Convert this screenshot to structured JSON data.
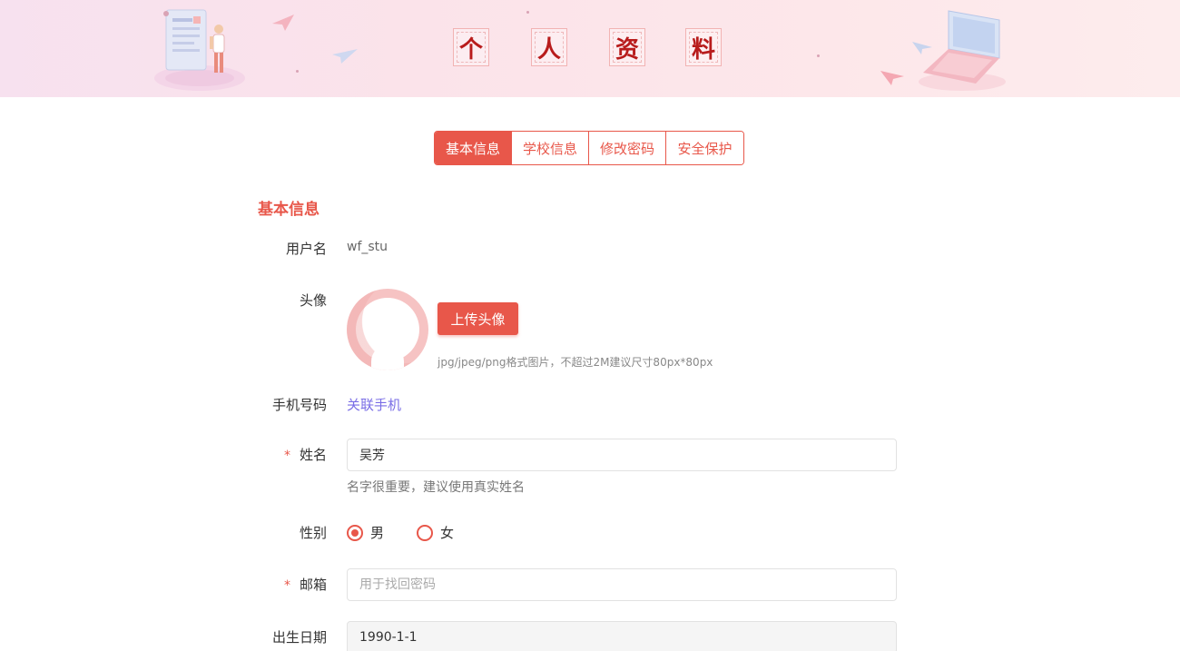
{
  "banner": {
    "title_chars": [
      "个",
      "人",
      "资",
      "料"
    ]
  },
  "tabs": [
    {
      "label": "基本信息",
      "active": true
    },
    {
      "label": "学校信息",
      "active": false
    },
    {
      "label": "修改密码",
      "active": false
    },
    {
      "label": "安全保护",
      "active": false
    }
  ],
  "section": {
    "title": "基本信息"
  },
  "form": {
    "username": {
      "label": "用户名",
      "value": "wf_stu"
    },
    "avatar": {
      "label": "头像",
      "upload_label": "上传头像",
      "hint": "jpg/jpeg/png格式图片，不超过2M建议尺寸80px*80px"
    },
    "phone": {
      "label": "手机号码",
      "link_text": "关联手机"
    },
    "name": {
      "label": "姓名",
      "required_mark": "*",
      "value": "吴芳",
      "help": "名字很重要，建议使用真实姓名"
    },
    "gender": {
      "label": "性别",
      "options": [
        {
          "label": "男",
          "selected": true
        },
        {
          "label": "女",
          "selected": false
        }
      ]
    },
    "email": {
      "label": "邮箱",
      "required_mark": "*",
      "value": "",
      "placeholder": "用于找回密码"
    },
    "birthday": {
      "label": "出生日期",
      "value": "1990-1-1"
    }
  },
  "colors": {
    "accent": "#e8574a",
    "link": "#7a6ee6"
  }
}
